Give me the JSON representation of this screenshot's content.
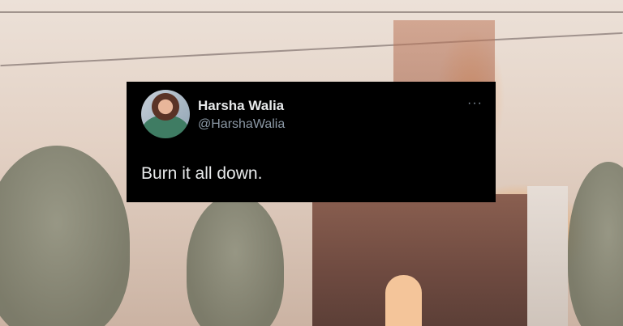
{
  "tweet": {
    "display_name": "Harsha Walia",
    "handle": "@HarshaWalia",
    "text": "Burn it all down.",
    "more_icon": "ellipsis-icon",
    "more_glyph": "···"
  },
  "colors": {
    "card_background": "#000000",
    "text_primary": "#e7e9ea",
    "text_secondary": "#8b98a5"
  }
}
